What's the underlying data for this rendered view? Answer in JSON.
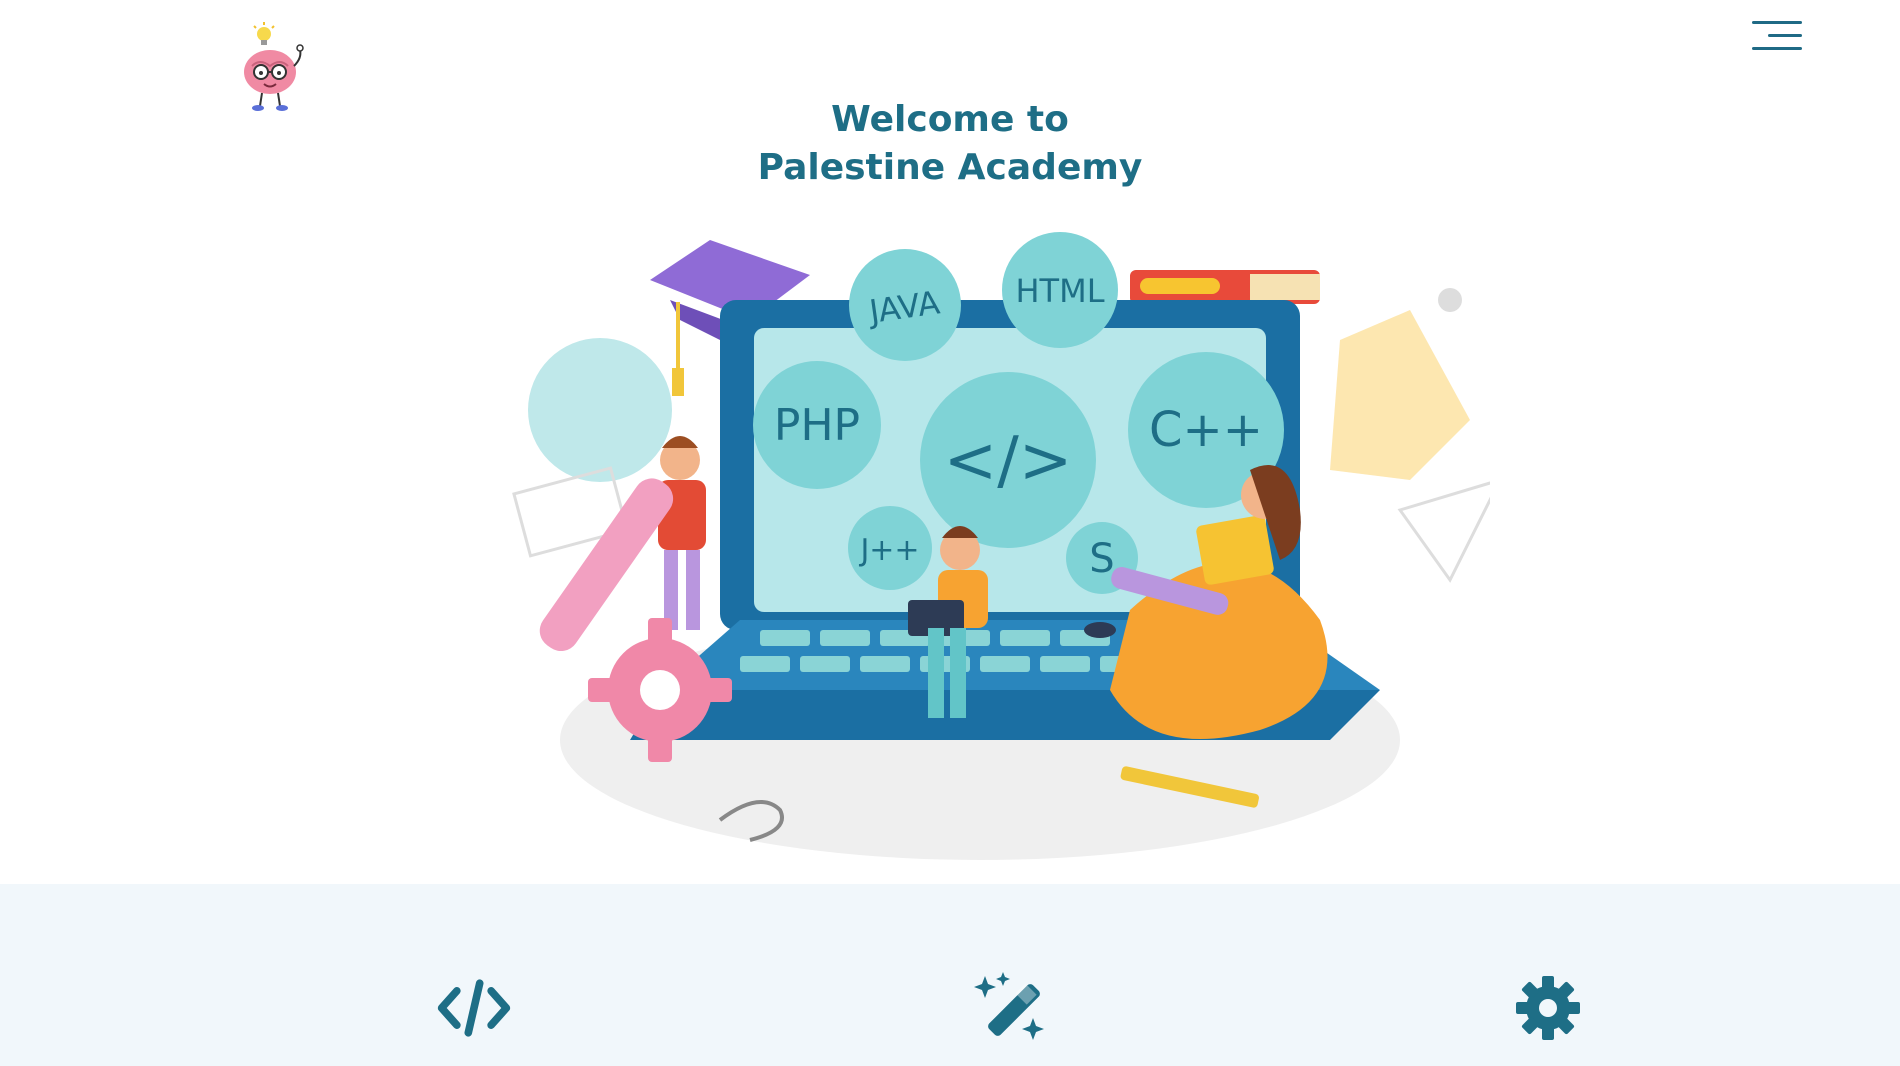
{
  "header": {
    "logo_icon": "brain-mascot-icon",
    "menu_icon": "hamburger-menu-icon"
  },
  "hero": {
    "title_line1": "Welcome to",
    "title_line2": "Palestine Academy"
  },
  "illustration": {
    "bubbles": {
      "java": "JAVA",
      "html": "HTML",
      "php": "PHP",
      "code": "</>",
      "cpp": "C++",
      "jpp": "J++",
      "s": "S"
    }
  },
  "features": [
    {
      "icon": "code-icon"
    },
    {
      "icon": "magic-wand-icon"
    },
    {
      "icon": "gear-icon"
    }
  ],
  "colors": {
    "primary": "#1e6e86",
    "band": "#f1f7fb",
    "teal": "#7fd3d6",
    "laptop": "#1b6fa3"
  }
}
